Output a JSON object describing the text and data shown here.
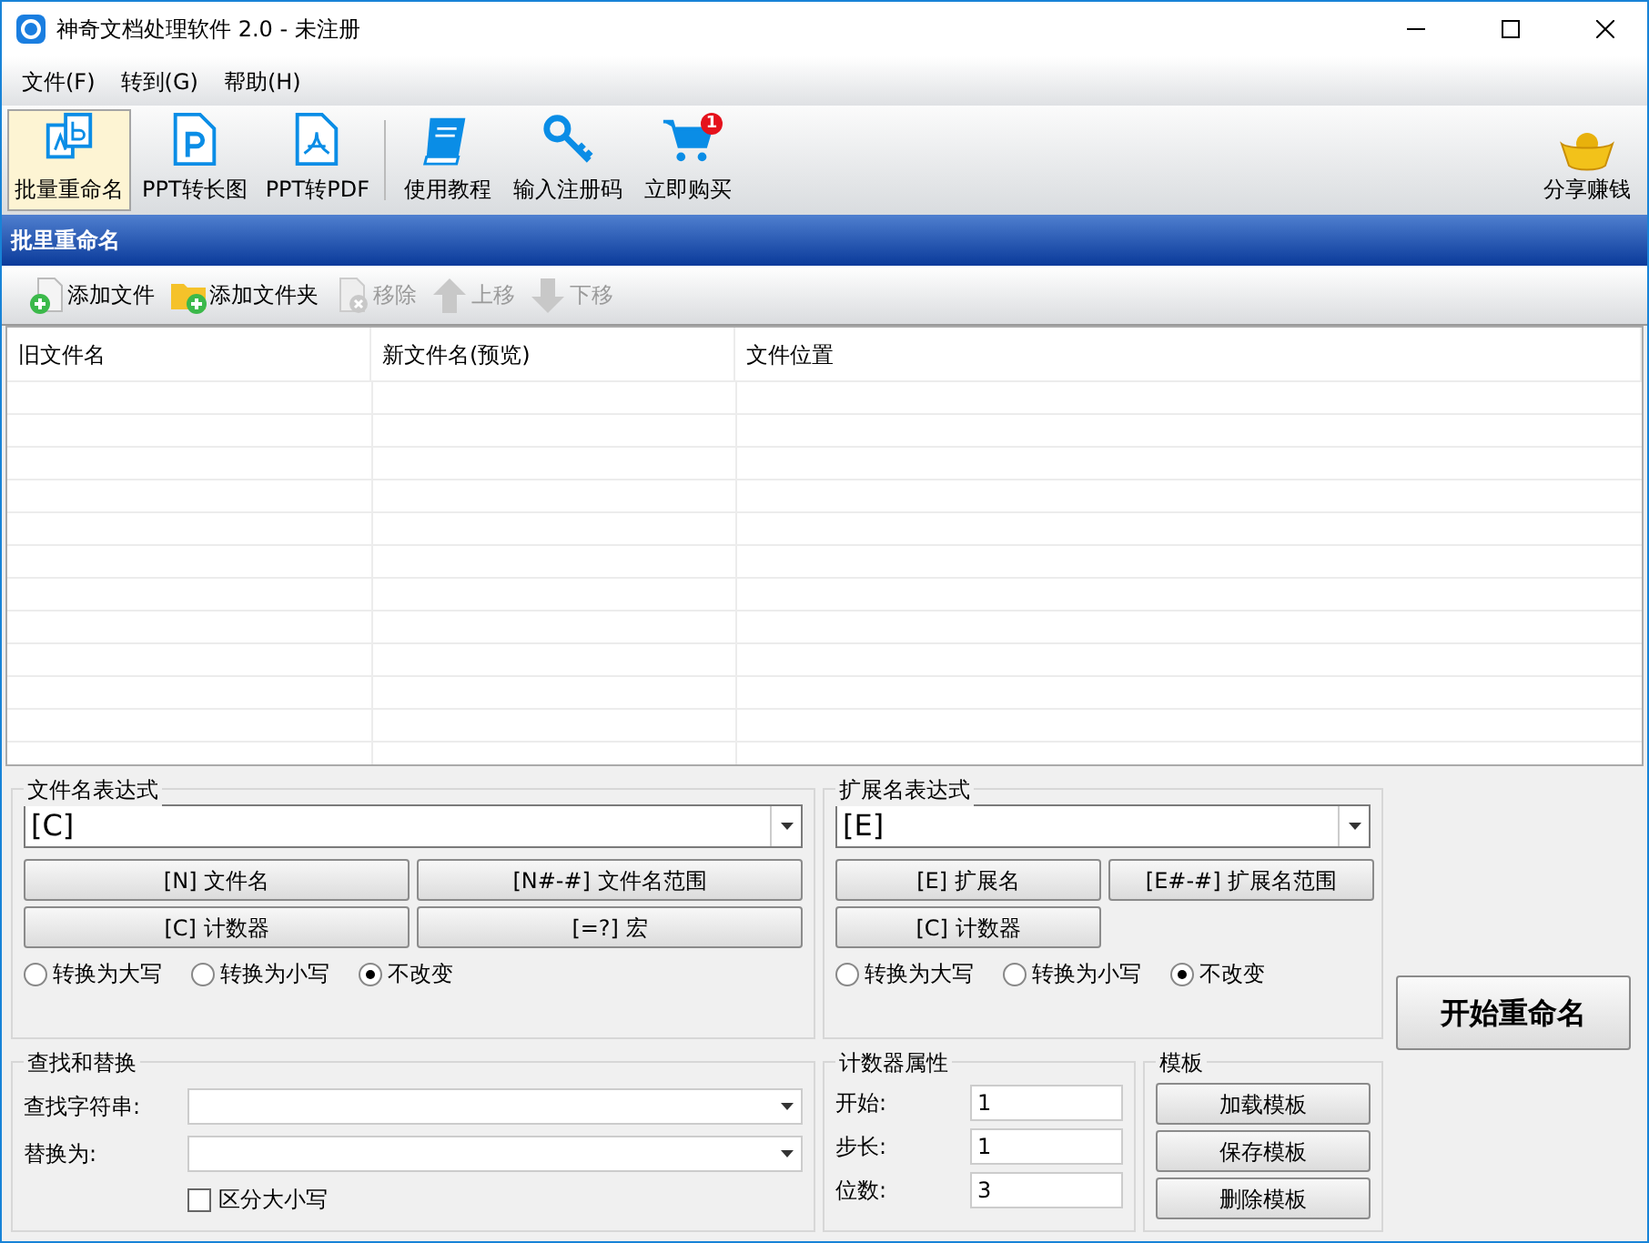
{
  "window": {
    "title": "神奇文档处理软件 2.0 - 未注册"
  },
  "menu": [
    "文件(F)",
    "转到(G)",
    "帮助(H)"
  ],
  "toolbar": [
    {
      "label": "批量重命名",
      "selected": true
    },
    {
      "label": "PPT转长图",
      "selected": false
    },
    {
      "label": "PPT转PDF",
      "selected": false
    },
    {
      "label": "使用教程",
      "selected": false
    },
    {
      "label": "输入注册码",
      "selected": false
    },
    {
      "label": "立即购买",
      "selected": false,
      "badge": "1"
    }
  ],
  "toolbar_right": {
    "label": "分享赚钱"
  },
  "panel_title": "批里重命名",
  "actions": [
    {
      "label": "添加文件",
      "disabled": false
    },
    {
      "label": "添加文件夹",
      "disabled": false
    },
    {
      "label": "移除",
      "disabled": true
    },
    {
      "label": "上移",
      "disabled": true
    },
    {
      "label": "下移",
      "disabled": true
    }
  ],
  "table": {
    "columns": [
      "旧文件名",
      "新文件名(预览)",
      "文件位置"
    ]
  },
  "filename_expression": {
    "title": "文件名表达式",
    "value": "[C]",
    "buttons": [
      "[N] 文件名",
      "[N#-#] 文件名范围",
      "[C] 计数器",
      "[=?] 宏"
    ],
    "case_options": [
      {
        "label": "转换为大写",
        "selected": false
      },
      {
        "label": "转换为小写",
        "selected": false
      },
      {
        "label": "不改变",
        "selected": true
      }
    ]
  },
  "extension_expression": {
    "title": "扩展名表达式",
    "value": "[E]",
    "buttons": [
      "[E] 扩展名",
      "[E#-#] 扩展名范围",
      "[C] 计数器"
    ],
    "case_options": [
      {
        "label": "转换为大写",
        "selected": false
      },
      {
        "label": "转换为小写",
        "selected": false
      },
      {
        "label": "不改变",
        "selected": true
      }
    ]
  },
  "start_button": "开始重命名",
  "find_replace": {
    "title": "查找和替换",
    "find_label": "查找字符串:",
    "replace_label": "替换为:",
    "case_sensitive": {
      "label": "区分大小写",
      "checked": false
    }
  },
  "counter": {
    "title": "计数器属性",
    "fields": [
      {
        "label": "开始:",
        "value": "1"
      },
      {
        "label": "步长:",
        "value": "1"
      },
      {
        "label": "位数:",
        "value": "3"
      }
    ]
  },
  "template": {
    "title": "模板",
    "buttons": [
      "加载模板",
      "保存模板",
      "删除模板"
    ]
  }
}
